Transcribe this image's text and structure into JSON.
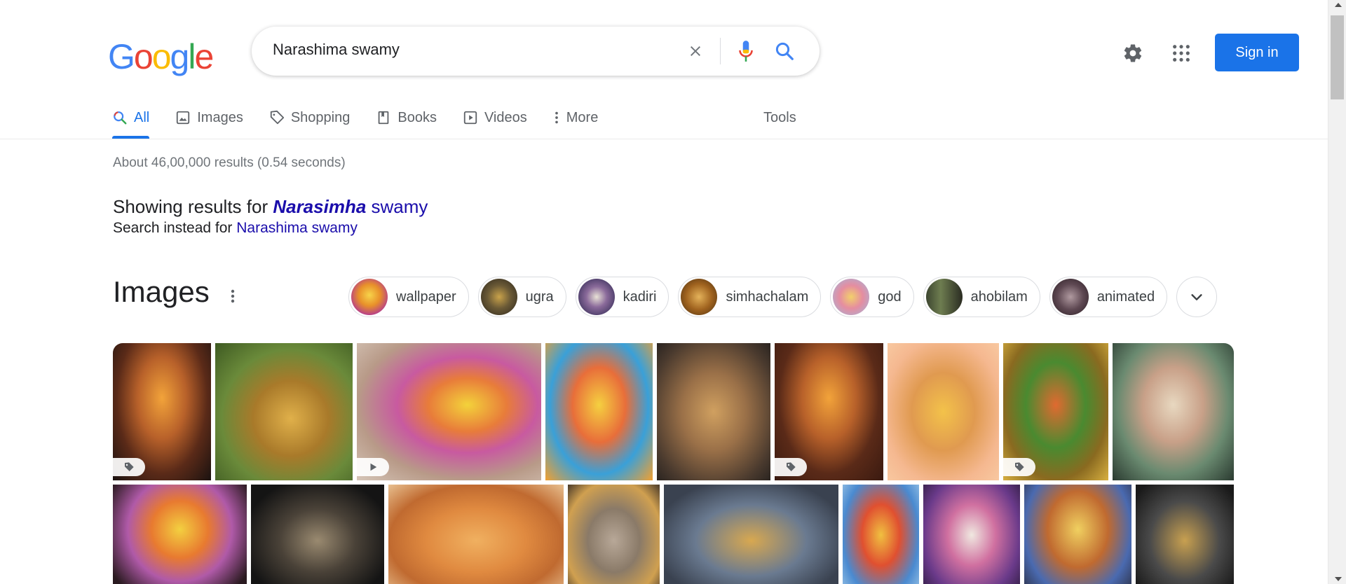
{
  "logo": {
    "letters": [
      "G",
      "o",
      "o",
      "g",
      "l",
      "e"
    ],
    "colors": [
      "#4285f4",
      "#ea4335",
      "#fbbc05",
      "#4285f4",
      "#34a853",
      "#ea4335"
    ]
  },
  "search": {
    "query": "Narashima swamy"
  },
  "header": {
    "sign_in_label": "Sign in"
  },
  "tabs": [
    {
      "label": "All",
      "icon": "search-icon",
      "active": true
    },
    {
      "label": "Images",
      "icon": "image-icon"
    },
    {
      "label": "Shopping",
      "icon": "tag-icon"
    },
    {
      "label": "Books",
      "icon": "book-icon"
    },
    {
      "label": "Videos",
      "icon": "video-icon"
    },
    {
      "label": "More",
      "icon": "more-vert-icon"
    }
  ],
  "tools_label": "Tools",
  "results": {
    "stats": "About 46,00,000 results (0.54 seconds)",
    "showing_prefix": "Showing results for ",
    "corrected_bold": "Narasimha",
    "corrected_rest": " swamy",
    "instead_prefix": "Search instead for ",
    "instead_query": "Narashima swamy"
  },
  "images_section": {
    "title": "Images",
    "chips": [
      {
        "label": "wallpaper"
      },
      {
        "label": "ugra"
      },
      {
        "label": "kadiri"
      },
      {
        "label": "simhachalam"
      },
      {
        "label": "god"
      },
      {
        "label": "ahobilam"
      },
      {
        "label": "animated"
      }
    ]
  },
  "accent_color": "#1a73e8",
  "link_color": "#1a0dab"
}
